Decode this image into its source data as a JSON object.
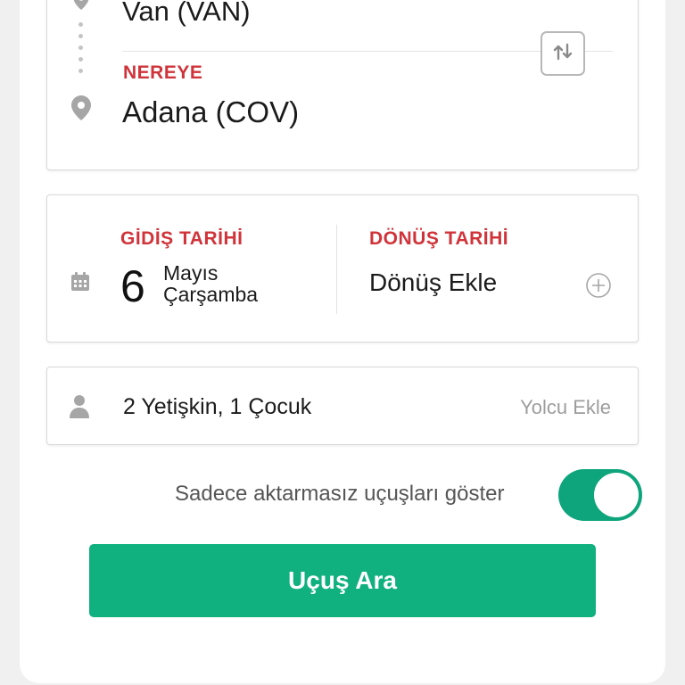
{
  "route": {
    "from_city": "Van (VAN)",
    "to_label": "NEREYE",
    "to_city": "Adana (COV)"
  },
  "dates": {
    "departure_label": "GİDİŞ TARİHİ",
    "departure_day": "6",
    "departure_month": "Mayıs",
    "departure_weekday": "Çarşamba",
    "return_label": "DÖNÜŞ TARİHİ",
    "return_placeholder": "Dönüş Ekle"
  },
  "passengers": {
    "summary": "2 Yetişkin, 1 Çocuk",
    "add_label": "Yolcu Ekle"
  },
  "direct_flights": {
    "label": "Sadece aktarmasız uçuşları göster",
    "enabled": true
  },
  "search_button": {
    "label": "Uçuş Ara"
  },
  "colors": {
    "accent_red": "#d0343a",
    "accent_green": "#10b07f",
    "icon_gray": "#a6a6a6"
  },
  "icons": {
    "origin": "map-pin-icon",
    "destination": "map-pin-icon",
    "swap": "swap-arrows-icon",
    "calendar": "calendar-icon",
    "add_return": "plus-circle-icon",
    "passenger": "person-icon"
  }
}
